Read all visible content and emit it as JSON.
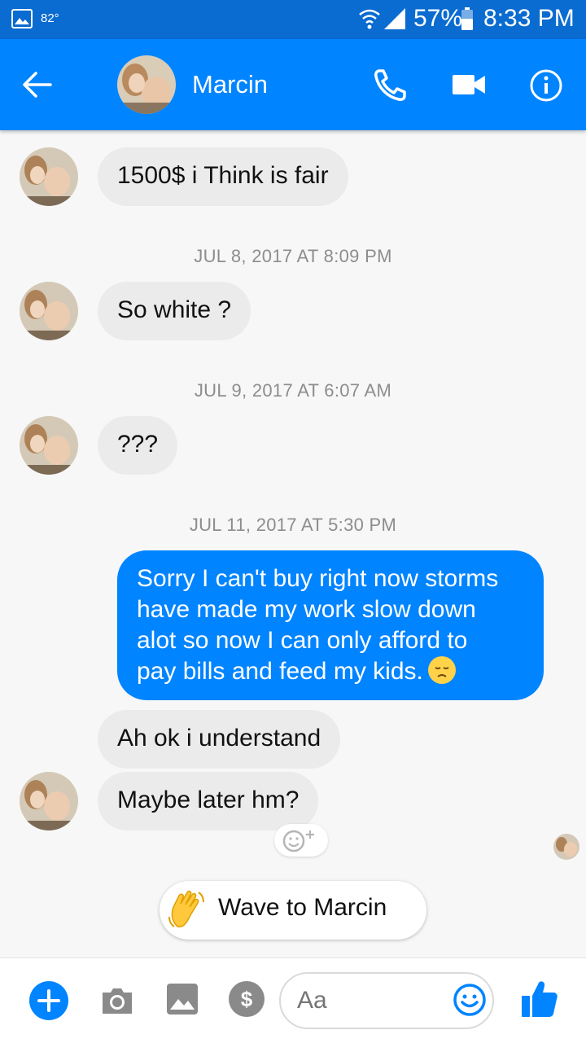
{
  "status_bar": {
    "temperature": "82°",
    "battery_percent": "57%",
    "time": "8:33 PM"
  },
  "header": {
    "contact_name": "Marcin",
    "back_icon": "arrow-left-icon",
    "call_icon": "phone-icon",
    "video_icon": "video-camera-icon",
    "info_icon": "info-icon"
  },
  "messages": [
    {
      "type": "incoming",
      "text": "1500$ i Think is fair"
    },
    {
      "type": "timestamp",
      "text": "JUL 8, 2017 AT 8:09 PM"
    },
    {
      "type": "incoming",
      "text": "So white ?"
    },
    {
      "type": "timestamp",
      "text": "JUL 9, 2017 AT 6:07 AM"
    },
    {
      "type": "incoming",
      "text": "???"
    },
    {
      "type": "timestamp",
      "text": "JUL 11, 2017 AT 5:30 PM"
    },
    {
      "type": "outgoing",
      "lines": [
        "Sorry I can't buy right now storms",
        "have made my work slow down",
        "alot so now I can only afford to",
        "pay bills and feed my kids."
      ],
      "emoji": "disappointed-face"
    },
    {
      "type": "incoming",
      "text": "Ah ok i understand"
    },
    {
      "type": "incoming",
      "text": "Maybe later hm?"
    }
  ],
  "wave": {
    "emoji": "👋",
    "label": "Wave to Marcin"
  },
  "composer": {
    "placeholder": "Aa",
    "pay_symbol": "$"
  },
  "colors": {
    "accent": "#0084ff",
    "status_bar": "#0a6bd0",
    "incoming_bubble": "#ebebeb"
  }
}
